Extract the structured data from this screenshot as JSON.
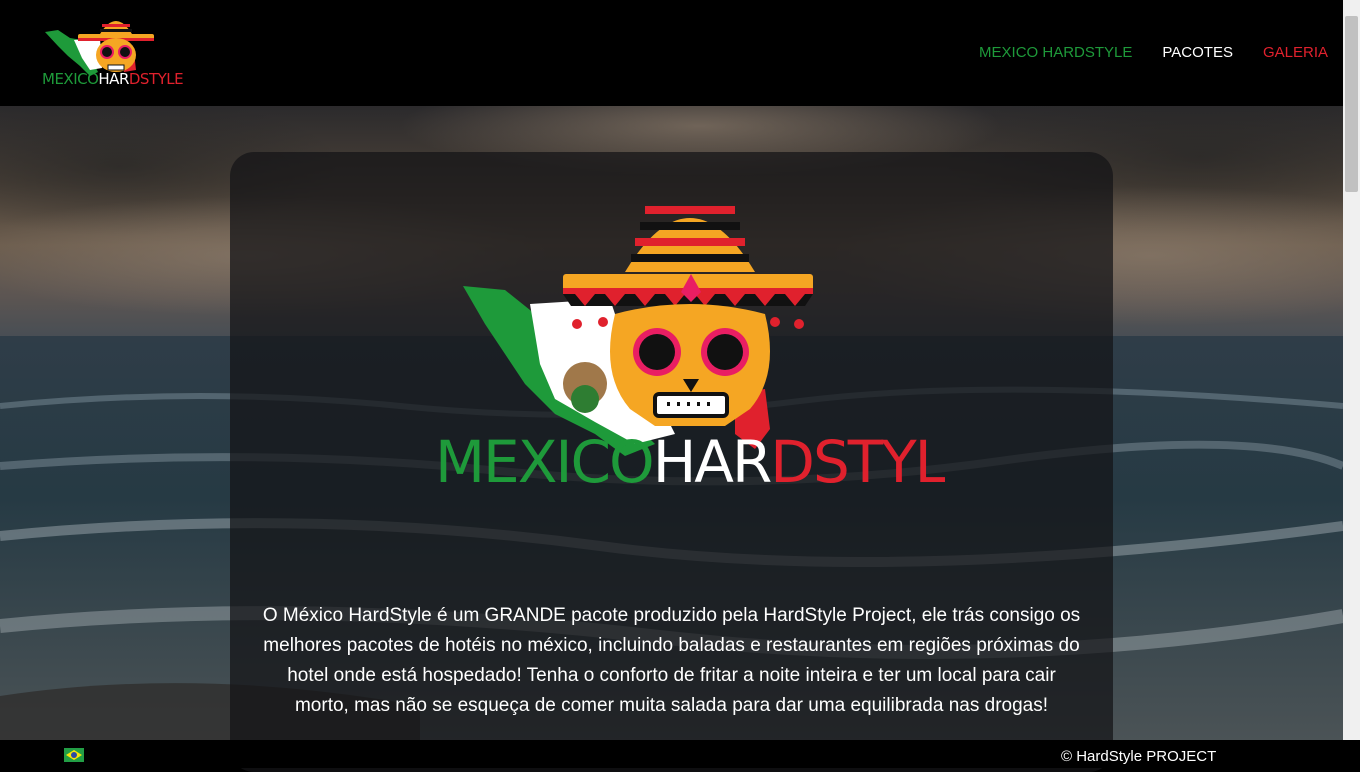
{
  "brand": {
    "logo_text_green": "MEXICO",
    "logo_text_white": "HAR",
    "logo_text_red": "DSTYLE"
  },
  "nav": [
    {
      "label": "MEXICO HARDSTYLE",
      "color": "#1e9a3a"
    },
    {
      "label": "PACOTES",
      "color": "#ffffff"
    },
    {
      "label": "GALERIA",
      "color": "#e0212d"
    }
  ],
  "main": {
    "hero_logo_text_green": "MEXICO",
    "hero_logo_text_white": "HAR",
    "hero_logo_text_red": "DSTYLE",
    "description": "O México HardStyle é um GRANDE pacote produzido pela HardStyle Project, ele trás consigo os melhores pacotes de hotéis no méxico, incluindo baladas e restaurantes em regiões próximas do hotel onde está hospedado! Tenha o conforto de fritar a noite inteira e ter um local para cair morto, mas não se esqueça de comer muita salada para dar uma equilibrada nas drogas!"
  },
  "footer": {
    "language_flag": "brazil-flag-icon",
    "copyright": "© HardStyle PROJECT"
  },
  "colors": {
    "green": "#1e9a3a",
    "red": "#e0212d",
    "white": "#ffffff",
    "header_bg": "#000000"
  }
}
